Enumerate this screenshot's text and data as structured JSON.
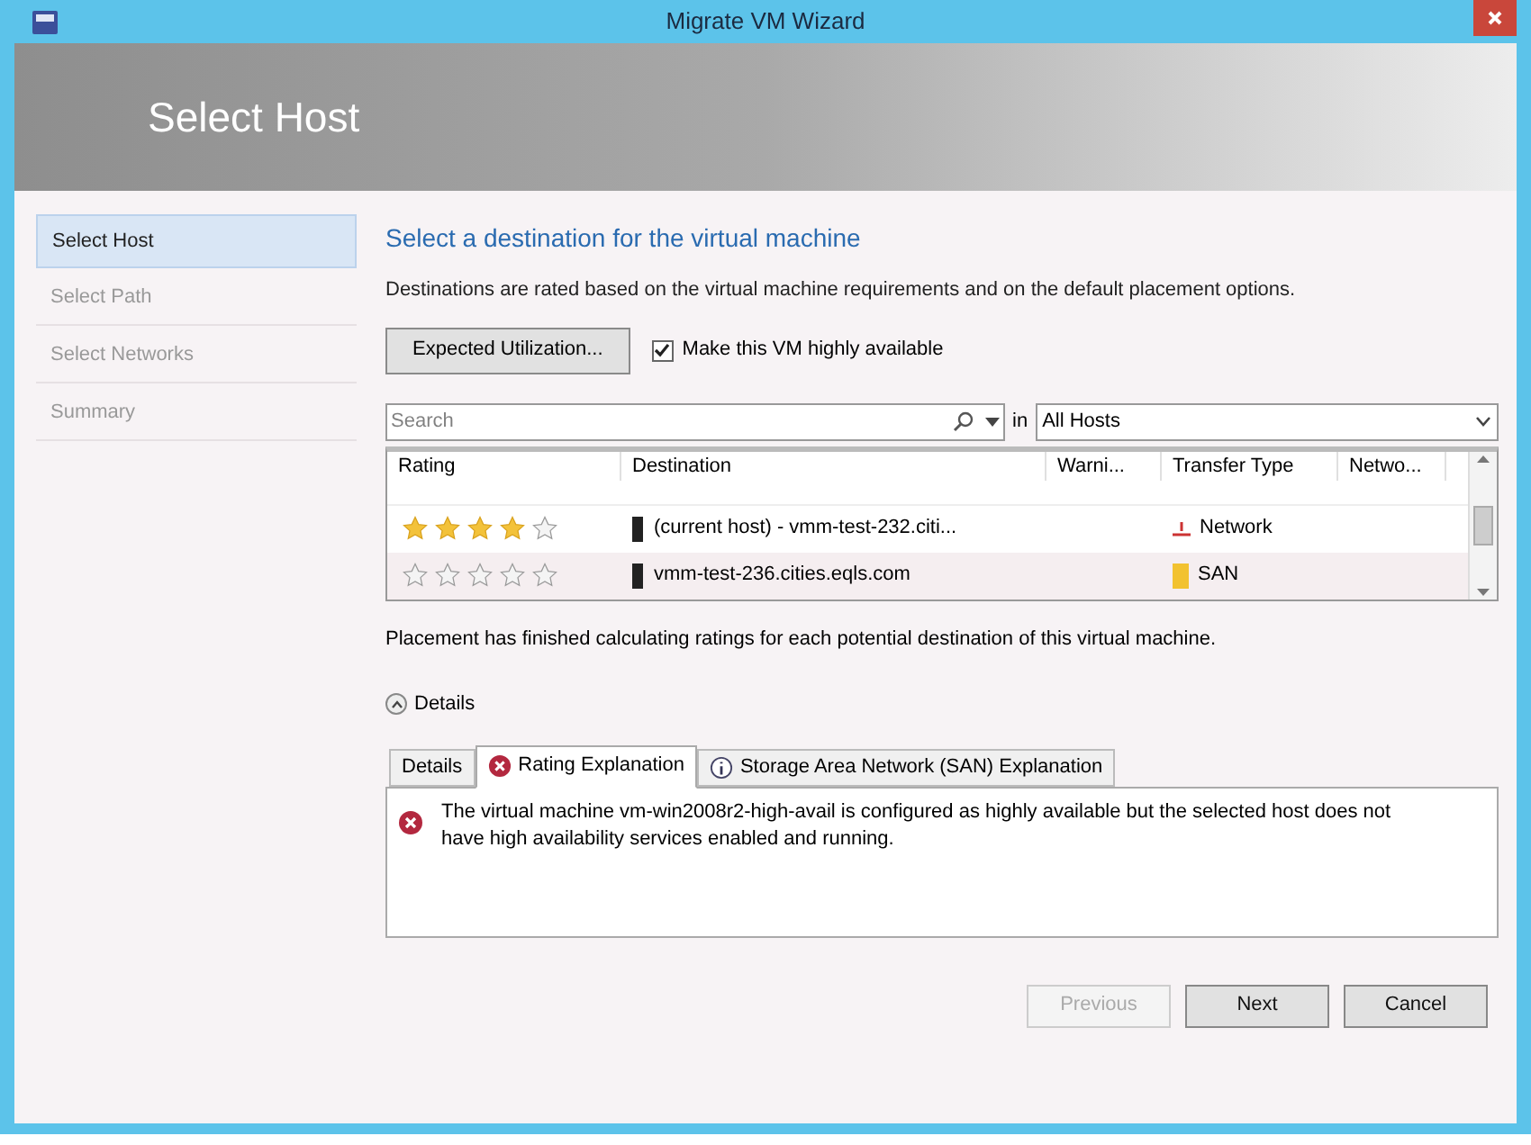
{
  "window": {
    "title": "Migrate VM Wizard"
  },
  "header": {
    "title": "Select Host"
  },
  "sidebar": {
    "items": [
      {
        "label": "Select Host",
        "selected": true
      },
      {
        "label": "Select Path",
        "selected": false
      },
      {
        "label": "Select Networks",
        "selected": false
      },
      {
        "label": "Summary",
        "selected": false
      }
    ]
  },
  "heading": "Select a destination for the virtual machine",
  "description": "Destinations are rated based on the virtual machine requirements and on the default placement options.",
  "expected_button": "Expected Utilization...",
  "ha_checkbox": {
    "label": "Make this VM highly available",
    "checked": true
  },
  "search": {
    "placeholder": "Search",
    "in_label": "in",
    "scope": "All Hosts"
  },
  "table": {
    "columns": [
      "Rating",
      "Destination",
      "Warni...",
      "Transfer Type",
      "Netwo..."
    ],
    "rows": [
      {
        "stars": 4,
        "destination": "(current host) - vmm-test-232.citi...",
        "transfer": "Network",
        "kind": "network",
        "selected": false
      },
      {
        "stars": 0,
        "destination": "vmm-test-236.cities.eqls.com",
        "transfer": "SAN",
        "kind": "san",
        "selected": true
      }
    ]
  },
  "status": "Placement has finished calculating ratings for each potential destination of this virtual machine.",
  "details_toggle": {
    "label": "Details",
    "expanded": true
  },
  "tabs": [
    {
      "label": "Details",
      "kind": "plain",
      "selected": false
    },
    {
      "label": "Rating Explanation",
      "kind": "error",
      "selected": true
    },
    {
      "label": "Storage Area Network (SAN) Explanation",
      "kind": "info",
      "selected": false
    }
  ],
  "message": "The virtual machine vm-win2008r2-high-avail is configured as highly available but the selected host does not have high availability services enabled and running.",
  "buttons": [
    {
      "label": "Previous",
      "disabled": true
    },
    {
      "label": "Next",
      "disabled": false
    },
    {
      "label": "Cancel",
      "disabled": false
    }
  ]
}
